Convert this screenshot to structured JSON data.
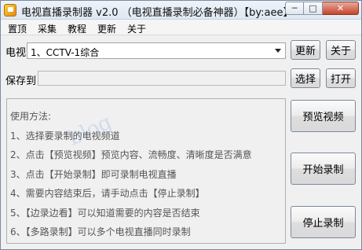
{
  "window": {
    "title": "电视直播录制器 v2.0 （电视直播录制必备神器）【by:aee】",
    "min_glyph": "─",
    "max_glyph": "□",
    "close_glyph": "✕"
  },
  "menu": {
    "items": [
      "置顶",
      "采集",
      "教程",
      "更新",
      "关于"
    ]
  },
  "channel": {
    "label": "电视",
    "selected": "1、CCTV-1综合",
    "update_button": "更新",
    "about_button": "关于"
  },
  "save": {
    "label": "保存到",
    "path_value": "",
    "choose_button": "选择",
    "open_button": "打开"
  },
  "instructions": {
    "lines": [
      "使用方法:",
      "1、选择要录制的电视频道",
      "2、点击【预览视频】预览内容、流畅度、清晰度是否满意",
      "3、点击【开始录制】即可录制电视直播",
      "4、需要内容结束后，请手动点击【停止录制】",
      "5、【边录边看】可以知道需要的内容是否结束",
      "6、【多路录制】可以多个电视直播同时录制"
    ]
  },
  "actions": {
    "preview_button": "预览视频",
    "start_button": "开始录制",
    "stop_button": "停止录制"
  },
  "watermark": "blog",
  "colors": {
    "window_bg": "#f0f0f0",
    "title_gradient_top": "#eef3f9",
    "close_button": "#c6452c"
  }
}
